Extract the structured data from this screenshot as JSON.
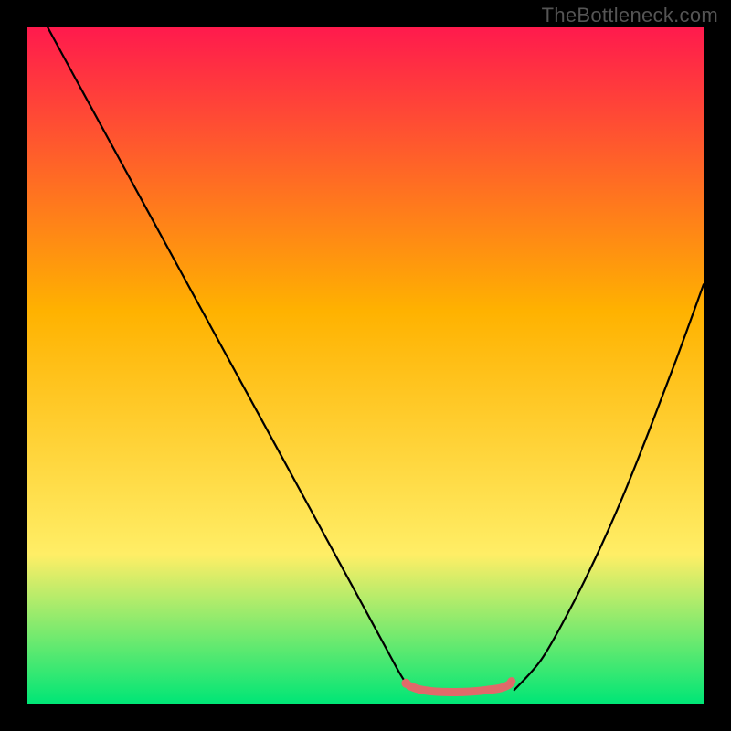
{
  "watermark": "TheBottleneck.com",
  "chart_data": {
    "type": "line",
    "title": "",
    "xlabel": "",
    "ylabel": "",
    "xlim": [
      0,
      100
    ],
    "ylim": [
      0,
      100
    ],
    "gradient": {
      "top": "#ff1a4d",
      "upper_mid": "#ffb200",
      "lower_mid": "#ffee66",
      "bottom": "#00e676"
    },
    "series": [
      {
        "name": "curve-left",
        "color": "#000000",
        "x": [
          3.0,
          8.0,
          14.0,
          20.0,
          26.0,
          32.0,
          38.0,
          44.0,
          50.0,
          54.6,
          56.0
        ],
        "y": [
          100.0,
          90.8,
          79.8,
          68.8,
          57.8,
          46.8,
          35.8,
          24.8,
          13.8,
          5.3,
          3.0
        ]
      },
      {
        "name": "curve-right",
        "color": "#000000",
        "x": [
          72.0,
          76.0,
          80.0,
          84.0,
          88.0,
          92.0,
          96.0,
          100.0
        ],
        "y": [
          2.0,
          6.5,
          13.5,
          21.5,
          30.5,
          40.5,
          51.0,
          62.0
        ]
      },
      {
        "name": "flat-segment",
        "color": "#e06a6a",
        "stroke_width": 9,
        "x": [
          56.5,
          58.0,
          60.0,
          62.0,
          64.0,
          66.0,
          68.0,
          70.0,
          71.2,
          71.6
        ],
        "y": [
          2.6,
          2.1,
          1.8,
          1.7,
          1.7,
          1.8,
          2.0,
          2.3,
          2.8,
          3.3
        ]
      }
    ],
    "markers": [
      {
        "name": "dot-left",
        "x": 56.0,
        "y": 3.0,
        "color": "#e06a6a",
        "r": 5
      }
    ]
  }
}
